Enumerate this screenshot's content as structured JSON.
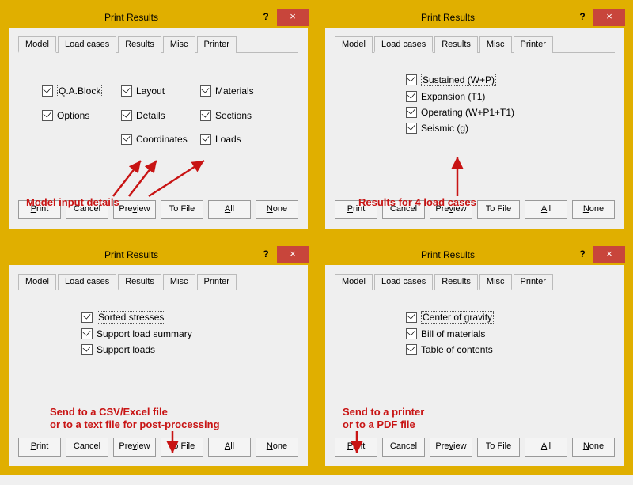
{
  "dialog_title": "Print Results",
  "help_symbol": "?",
  "close_symbol": "×",
  "tabs": {
    "model": "Model",
    "loadcases": "Load cases",
    "results": "Results",
    "misc": "Misc",
    "printer": "Printer"
  },
  "buttons": {
    "print": "Print",
    "cancel": "Cancel",
    "preview": "Preview",
    "tofile": "To File",
    "all": "All",
    "none": "None"
  },
  "model": {
    "qa_block": "Q.A.Block",
    "options": "Options",
    "layout": "Layout",
    "details": "Details",
    "coordinates": "Coordinates",
    "materials": "Materials",
    "sections": "Sections",
    "loads": "Loads"
  },
  "loadcases": {
    "sustained": "Sustained (W+P)",
    "expansion": "Expansion (T1)",
    "operating": "Operating (W+P1+T1)",
    "seismic": "Seismic (g)"
  },
  "results": {
    "sorted": "Sorted stresses",
    "support_summary": "Support load summary",
    "support_loads": "Support loads"
  },
  "misc": {
    "cog": "Center of gravity",
    "bom": "Bill of materials",
    "toc": "Table of contents"
  },
  "annotations": {
    "model": "Model input details",
    "loadcases": "Results for 4 load cases",
    "results_l1": "Send to a CSV/Excel file",
    "results_l2": "or to a text file for post-processing",
    "misc_l1": "Send to a printer",
    "misc_l2": "or to a PDF file"
  }
}
